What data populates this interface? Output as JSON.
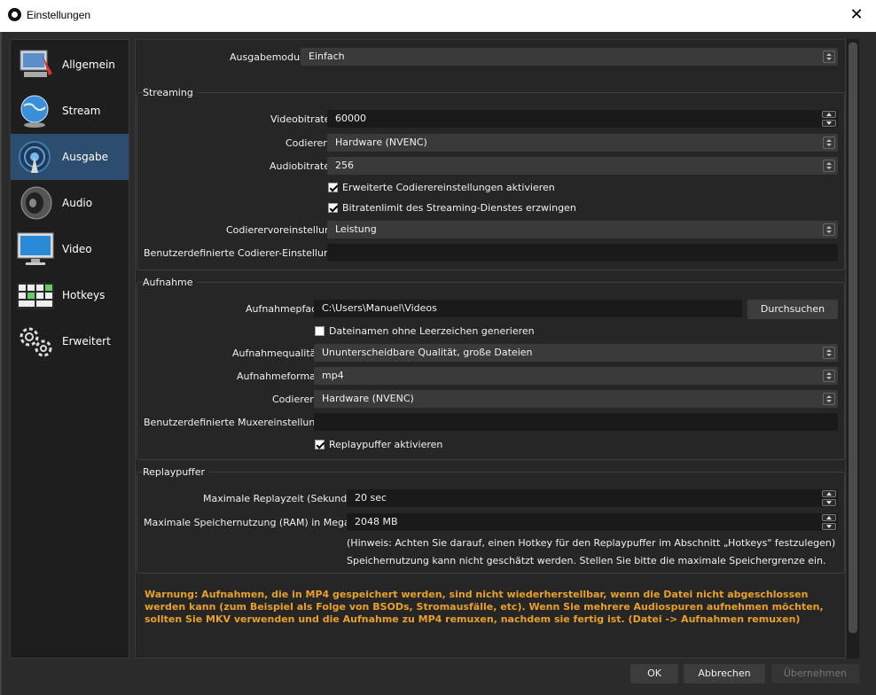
{
  "window": {
    "title": "Einstellungen",
    "close": "✕"
  },
  "sidebar": {
    "items": [
      {
        "label": "Allgemein",
        "icon": "general-icon"
      },
      {
        "label": "Stream",
        "icon": "globe-icon"
      },
      {
        "label": "Ausgabe",
        "icon": "broadcast-icon",
        "active": true
      },
      {
        "label": "Audio",
        "icon": "speaker-icon"
      },
      {
        "label": "Video",
        "icon": "monitor-icon"
      },
      {
        "label": "Hotkeys",
        "icon": "keyboard-icon"
      },
      {
        "label": "Erweitert",
        "icon": "gears-icon"
      }
    ]
  },
  "output_mode": {
    "label": "Ausgabemodus",
    "value": "Einfach"
  },
  "streaming": {
    "title": "Streaming",
    "video_bitrate": {
      "label": "Videobitrate",
      "value": "60000"
    },
    "encoder": {
      "label": "Codierer",
      "value": "Hardware (NVENC)"
    },
    "audio_bitrate": {
      "label": "Audiobitrate",
      "value": "256"
    },
    "advanced_encoder_check": {
      "label": "Erweiterte Codierereinstellungen aktivieren",
      "checked": true
    },
    "bitrate_limit_check": {
      "label": "Bitratenlimit des Streaming-Dienstes erzwingen",
      "checked": true
    },
    "encoder_preset": {
      "label": "Codierervoreinstellung",
      "value": "Leistung"
    },
    "custom_encoder": {
      "label": "Benutzerdefinierte Codierer-Einstellungen",
      "value": ""
    }
  },
  "recording": {
    "title": "Aufnahme",
    "path": {
      "label": "Aufnahmepfad",
      "value": "C:\\Users\\Manuel\\Videos"
    },
    "browse_button": "Durchsuchen",
    "no_spaces_check": {
      "label": "Dateinamen ohne Leerzeichen generieren",
      "checked": false
    },
    "quality": {
      "label": "Aufnahmequalität",
      "value": "Ununterscheidbare Qualität, große Dateien"
    },
    "format": {
      "label": "Aufnahmeformat",
      "value": "mp4"
    },
    "encoder": {
      "label": "Codierer",
      "value": "Hardware (NVENC)"
    },
    "custom_muxer": {
      "label": "Benutzerdefinierte Muxereinstellungen",
      "value": ""
    },
    "replay_buffer_check": {
      "label": "Replaypuffer aktivieren",
      "checked": true
    }
  },
  "replay_buffer": {
    "title": "Replaypuffer",
    "max_time": {
      "label": "Maximale Replayzeit (Sekunden)",
      "value": "20 sec"
    },
    "max_memory": {
      "label": "Maximale Speichernutzung (RAM) in Megabyte",
      "value": "2048 MB"
    },
    "hint_line1": "(Hinweis: Achten Sie darauf, einen Hotkey für den Replaypuffer im Abschnitt „Hotkeys\" festzulegen)",
    "hint_line2": "Speichernutzung kann nicht geschätzt werden. Stellen Sie bitte die maximale Speichergrenze ein."
  },
  "warning": "Warnung: Aufnahmen, die in MP4 gespeichert werden, sind nicht wiederherstellbar, wenn die Datei nicht abgeschlossen werden kann (zum Beispiel als Folge von BSODs, Stromausfälle, etc). Wenn Sie mehrere Audiospuren aufnehmen möchten, sollten Sie MKV verwenden und die Aufnahme zu MP4 remuxen, nachdem sie fertig ist. (Datei -> Aufnahmen remuxen)",
  "footer": {
    "ok": "OK",
    "cancel": "Abbrechen",
    "apply": "Übernehmen"
  },
  "colors": {
    "accent_active": "#2c4d6e",
    "warning": "#e8a028",
    "background": "#262626"
  }
}
